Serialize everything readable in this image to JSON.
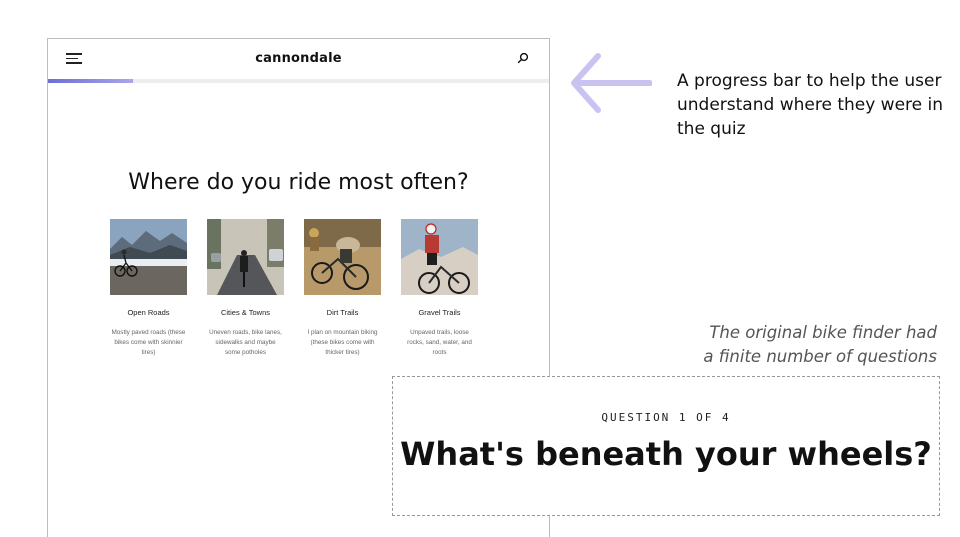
{
  "brand": {
    "logo_text": "cannondale"
  },
  "progress": {
    "fraction": 0.17
  },
  "quiz": {
    "question": "Where do you ride most often?",
    "options": [
      {
        "label": "Open Roads",
        "description": "Mostly paved roads (these bikes come with skinnier tires)",
        "image": "rider-on-mountain-road"
      },
      {
        "label": "Cities & Towns",
        "description": "Uneven roads, bike lanes, sidewalks and maybe some potholes",
        "image": "rider-on-city-street"
      },
      {
        "label": "Dirt Trails",
        "description": "I plan on mountain biking (these bikes come with thicker tires)",
        "image": "riders-on-dirt-trail"
      },
      {
        "label": "Gravel Trails",
        "description": "Unpaved trails, loose rocks, sand, water, and roots",
        "image": "rider-on-gravel-trail"
      }
    ]
  },
  "annotations": {
    "progress_note": "A progress bar to help the user understand where they were in the quiz",
    "original_note_line1": "The original bike finder had",
    "original_note_line2": "a finite number of questions",
    "callout_eyebrow": "QUESTION 1 OF 4",
    "callout_headline": "What's beneath your wheels?"
  },
  "colors": {
    "progress": "#6b6fd6",
    "arrow": "#c9c3f2"
  }
}
